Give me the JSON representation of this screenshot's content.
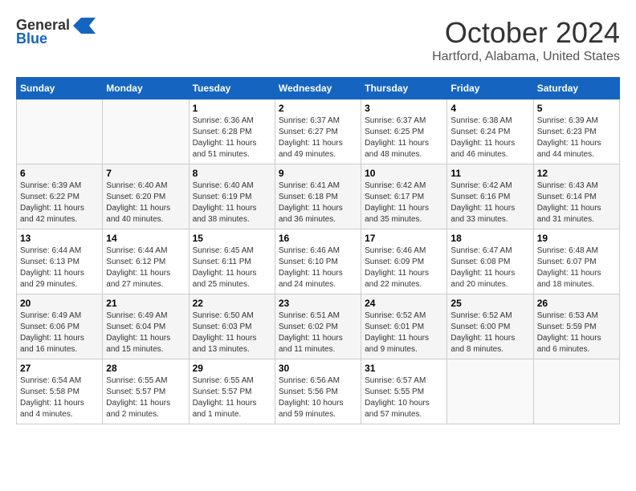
{
  "logo": {
    "general": "General",
    "blue": "Blue"
  },
  "title": "October 2024",
  "location": "Hartford, Alabama, United States",
  "days_header": [
    "Sunday",
    "Monday",
    "Tuesday",
    "Wednesday",
    "Thursday",
    "Friday",
    "Saturday"
  ],
  "weeks": [
    [
      {
        "day": "",
        "detail": ""
      },
      {
        "day": "",
        "detail": ""
      },
      {
        "day": "1",
        "detail": "Sunrise: 6:36 AM\nSunset: 6:28 PM\nDaylight: 11 hours and 51 minutes."
      },
      {
        "day": "2",
        "detail": "Sunrise: 6:37 AM\nSunset: 6:27 PM\nDaylight: 11 hours and 49 minutes."
      },
      {
        "day": "3",
        "detail": "Sunrise: 6:37 AM\nSunset: 6:25 PM\nDaylight: 11 hours and 48 minutes."
      },
      {
        "day": "4",
        "detail": "Sunrise: 6:38 AM\nSunset: 6:24 PM\nDaylight: 11 hours and 46 minutes."
      },
      {
        "day": "5",
        "detail": "Sunrise: 6:39 AM\nSunset: 6:23 PM\nDaylight: 11 hours and 44 minutes."
      }
    ],
    [
      {
        "day": "6",
        "detail": "Sunrise: 6:39 AM\nSunset: 6:22 PM\nDaylight: 11 hours and 42 minutes."
      },
      {
        "day": "7",
        "detail": "Sunrise: 6:40 AM\nSunset: 6:20 PM\nDaylight: 11 hours and 40 minutes."
      },
      {
        "day": "8",
        "detail": "Sunrise: 6:40 AM\nSunset: 6:19 PM\nDaylight: 11 hours and 38 minutes."
      },
      {
        "day": "9",
        "detail": "Sunrise: 6:41 AM\nSunset: 6:18 PM\nDaylight: 11 hours and 36 minutes."
      },
      {
        "day": "10",
        "detail": "Sunrise: 6:42 AM\nSunset: 6:17 PM\nDaylight: 11 hours and 35 minutes."
      },
      {
        "day": "11",
        "detail": "Sunrise: 6:42 AM\nSunset: 6:16 PM\nDaylight: 11 hours and 33 minutes."
      },
      {
        "day": "12",
        "detail": "Sunrise: 6:43 AM\nSunset: 6:14 PM\nDaylight: 11 hours and 31 minutes."
      }
    ],
    [
      {
        "day": "13",
        "detail": "Sunrise: 6:44 AM\nSunset: 6:13 PM\nDaylight: 11 hours and 29 minutes."
      },
      {
        "day": "14",
        "detail": "Sunrise: 6:44 AM\nSunset: 6:12 PM\nDaylight: 11 hours and 27 minutes."
      },
      {
        "day": "15",
        "detail": "Sunrise: 6:45 AM\nSunset: 6:11 PM\nDaylight: 11 hours and 25 minutes."
      },
      {
        "day": "16",
        "detail": "Sunrise: 6:46 AM\nSunset: 6:10 PM\nDaylight: 11 hours and 24 minutes."
      },
      {
        "day": "17",
        "detail": "Sunrise: 6:46 AM\nSunset: 6:09 PM\nDaylight: 11 hours and 22 minutes."
      },
      {
        "day": "18",
        "detail": "Sunrise: 6:47 AM\nSunset: 6:08 PM\nDaylight: 11 hours and 20 minutes."
      },
      {
        "day": "19",
        "detail": "Sunrise: 6:48 AM\nSunset: 6:07 PM\nDaylight: 11 hours and 18 minutes."
      }
    ],
    [
      {
        "day": "20",
        "detail": "Sunrise: 6:49 AM\nSunset: 6:06 PM\nDaylight: 11 hours and 16 minutes."
      },
      {
        "day": "21",
        "detail": "Sunrise: 6:49 AM\nSunset: 6:04 PM\nDaylight: 11 hours and 15 minutes."
      },
      {
        "day": "22",
        "detail": "Sunrise: 6:50 AM\nSunset: 6:03 PM\nDaylight: 11 hours and 13 minutes."
      },
      {
        "day": "23",
        "detail": "Sunrise: 6:51 AM\nSunset: 6:02 PM\nDaylight: 11 hours and 11 minutes."
      },
      {
        "day": "24",
        "detail": "Sunrise: 6:52 AM\nSunset: 6:01 PM\nDaylight: 11 hours and 9 minutes."
      },
      {
        "day": "25",
        "detail": "Sunrise: 6:52 AM\nSunset: 6:00 PM\nDaylight: 11 hours and 8 minutes."
      },
      {
        "day": "26",
        "detail": "Sunrise: 6:53 AM\nSunset: 5:59 PM\nDaylight: 11 hours and 6 minutes."
      }
    ],
    [
      {
        "day": "27",
        "detail": "Sunrise: 6:54 AM\nSunset: 5:58 PM\nDaylight: 11 hours and 4 minutes."
      },
      {
        "day": "28",
        "detail": "Sunrise: 6:55 AM\nSunset: 5:57 PM\nDaylight: 11 hours and 2 minutes."
      },
      {
        "day": "29",
        "detail": "Sunrise: 6:55 AM\nSunset: 5:57 PM\nDaylight: 11 hours and 1 minute."
      },
      {
        "day": "30",
        "detail": "Sunrise: 6:56 AM\nSunset: 5:56 PM\nDaylight: 10 hours and 59 minutes."
      },
      {
        "day": "31",
        "detail": "Sunrise: 6:57 AM\nSunset: 5:55 PM\nDaylight: 10 hours and 57 minutes."
      },
      {
        "day": "",
        "detail": ""
      },
      {
        "day": "",
        "detail": ""
      }
    ]
  ]
}
